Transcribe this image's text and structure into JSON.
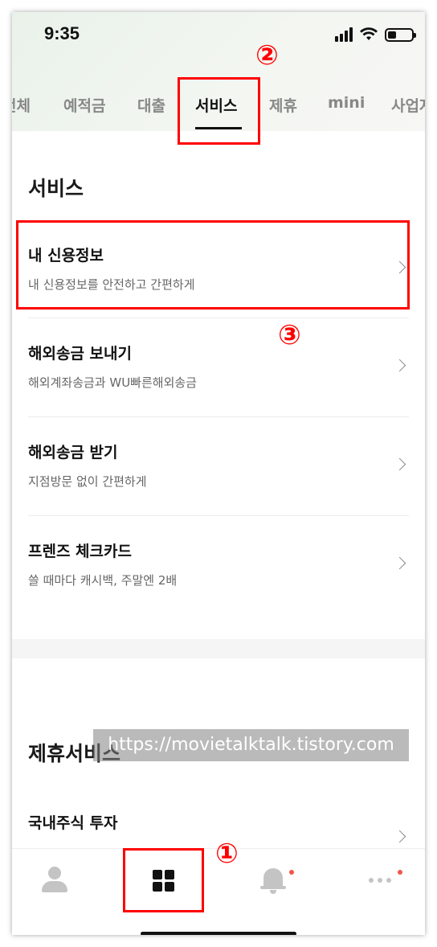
{
  "status_bar": {
    "time": "9:35"
  },
  "tabs": [
    {
      "label": "전체"
    },
    {
      "label": "예적금"
    },
    {
      "label": "대출"
    },
    {
      "label": "서비스"
    },
    {
      "label": "제휴"
    },
    {
      "label": "mini"
    },
    {
      "label": "사업자"
    }
  ],
  "active_tab": "서비스",
  "services": {
    "title": "서비스",
    "items": [
      {
        "title": "내 신용정보",
        "desc": "내 신용정보를 안전하고 간편하게"
      },
      {
        "title": "해외송금 보내기",
        "desc": "해외계좌송금과 WU빠른해외송금"
      },
      {
        "title": "해외송금 받기",
        "desc": "지점방문 없이 간편하게"
      },
      {
        "title": "프렌즈 체크카드",
        "desc": "쓸 때마다 캐시백, 주말엔 2배"
      }
    ]
  },
  "partner_services": {
    "title": "제휴서비스",
    "items": [
      {
        "title": "국내주식 투자"
      }
    ]
  },
  "watermark": "https://movietalktalk.tistory.com",
  "annotations": {
    "marker1": "①",
    "marker2": "②",
    "marker3": "③"
  },
  "colors": {
    "highlight": "#ff0000",
    "notification_dot": "#f2544b"
  }
}
